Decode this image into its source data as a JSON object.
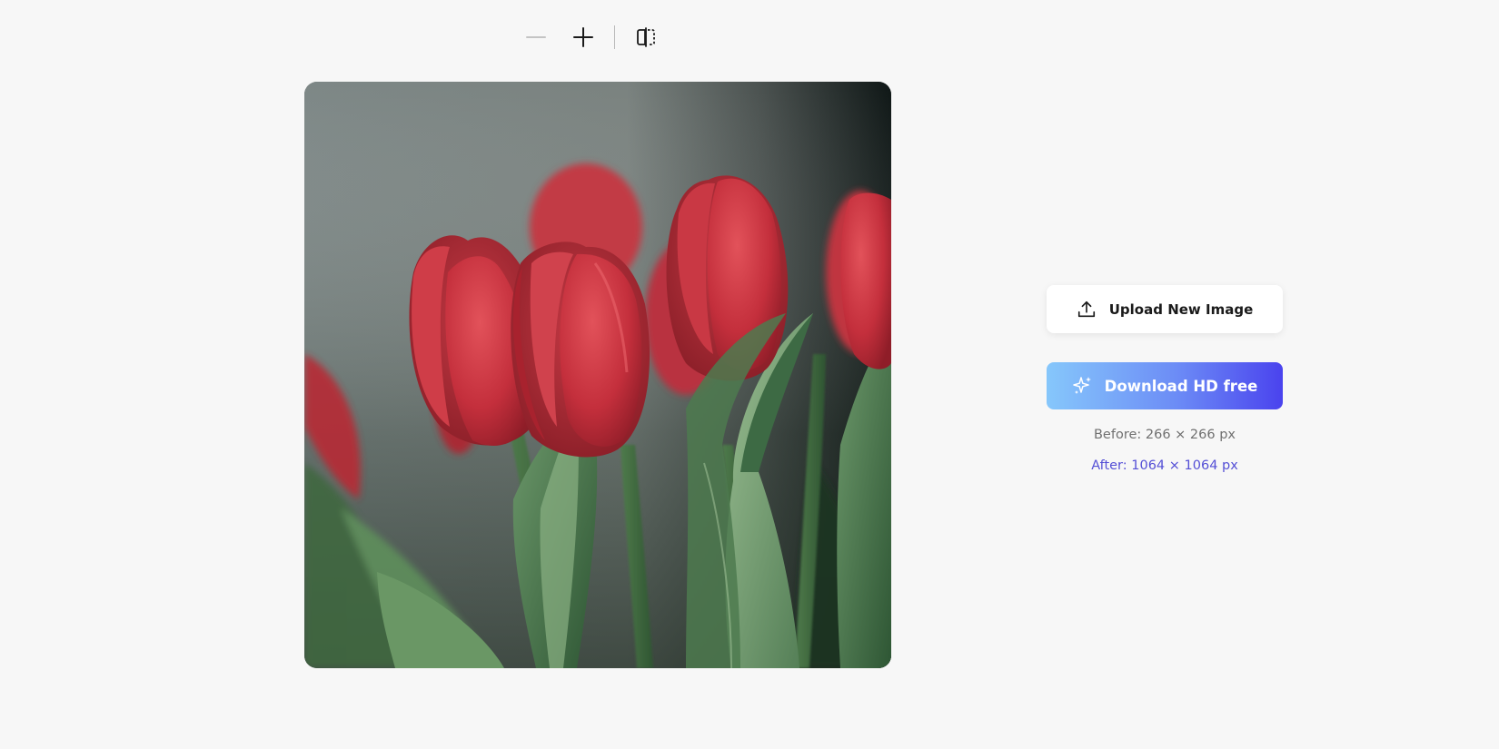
{
  "toolbar": {
    "zoom_out_icon": "minus-icon",
    "zoom_in_icon": "plus-icon",
    "compare_icon": "compare-split-icon"
  },
  "preview": {
    "subject": "red-tulips-photo"
  },
  "actions": {
    "upload_label": "Upload New Image",
    "upload_icon": "upload-icon",
    "download_label": "Download HD free",
    "download_icon": "sparkle-icon"
  },
  "info": {
    "before": "Before: 266 × 266 px",
    "after": "After: 1064 × 1064 px"
  },
  "colors": {
    "background": "#f7f7f7",
    "accent_start": "#86c7fb",
    "accent_end": "#4a43ee",
    "after_text": "#5550d6",
    "before_text": "#707070"
  }
}
